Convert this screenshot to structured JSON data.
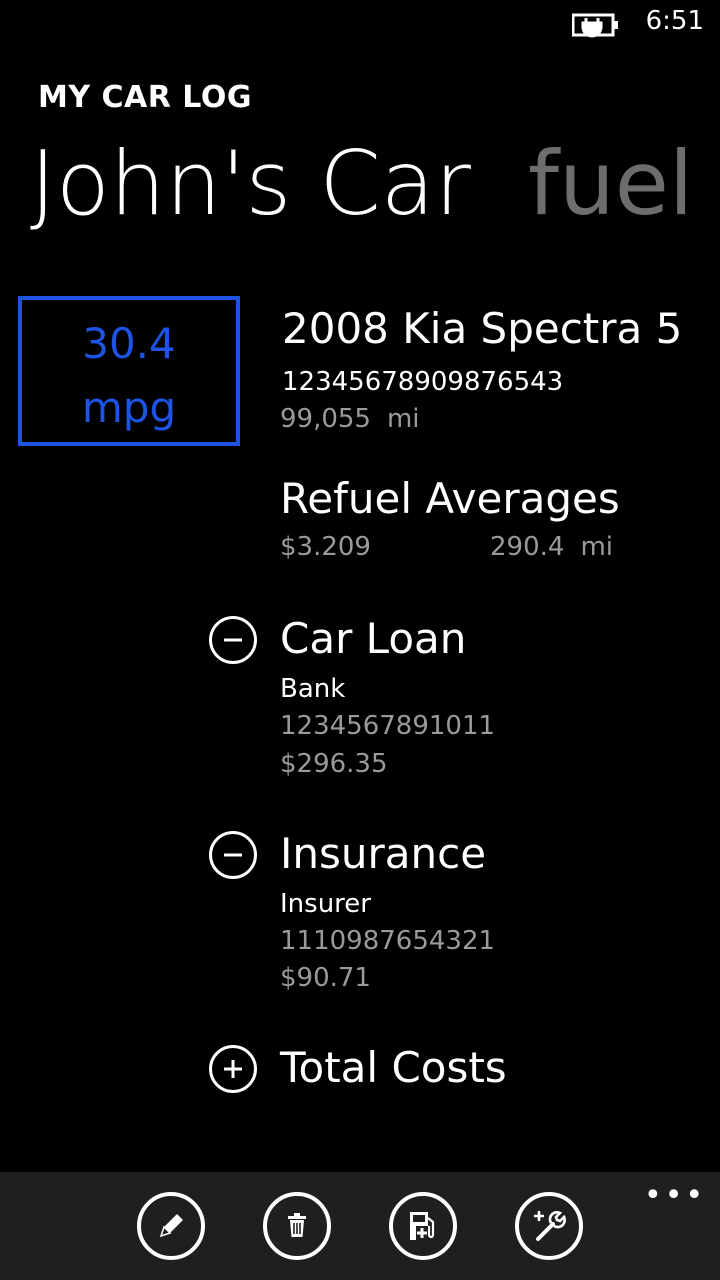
{
  "status": {
    "time": "6:51",
    "battery_icon": "battery-charging-icon"
  },
  "header": {
    "app_title": "MY CAR LOG",
    "pivot_current": "John's Car",
    "pivot_next": "fuel"
  },
  "mpg": {
    "value": "30.4",
    "unit": "mpg",
    "color": "#1e54e6"
  },
  "car": {
    "name": "2008 Kia Spectra 5",
    "vin": "12345678909876543",
    "odometer": "99,055",
    "odometer_unit": "mi"
  },
  "refuel": {
    "title": "Refuel Averages",
    "price": "$3.209",
    "distance": "290.4",
    "distance_unit": "mi"
  },
  "sections": [
    {
      "title": "Car Loan",
      "line1": "Bank",
      "line2": "1234567891011",
      "line3": "$296.35",
      "toggle_icon": "minus-circle-icon"
    },
    {
      "title": "Insurance",
      "line1": "Insurer",
      "line2": "1110987654321",
      "line3": "$90.71",
      "toggle_icon": "minus-circle-icon"
    },
    {
      "title": "Total Costs",
      "toggle_icon": "plus-circle-icon"
    }
  ],
  "appbar": {
    "buttons": [
      {
        "icon": "edit-icon"
      },
      {
        "icon": "delete-icon"
      },
      {
        "icon": "add-fuel-icon"
      },
      {
        "icon": "add-service-icon"
      }
    ],
    "more": "•••"
  }
}
